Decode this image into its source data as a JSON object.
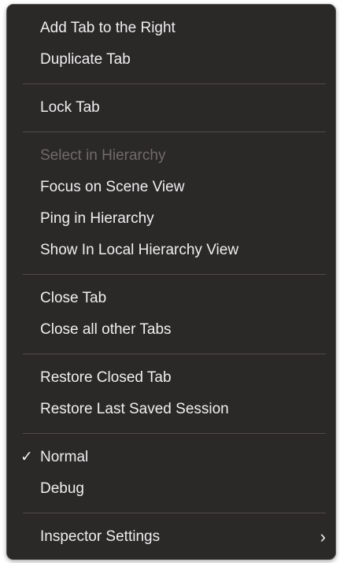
{
  "menu": {
    "groups": [
      {
        "items": [
          {
            "label": "Add Tab to the Right",
            "enabled": true
          },
          {
            "label": "Duplicate Tab",
            "enabled": true
          }
        ]
      },
      {
        "items": [
          {
            "label": "Lock Tab",
            "enabled": true
          }
        ]
      },
      {
        "items": [
          {
            "label": "Select in Hierarchy",
            "enabled": false
          },
          {
            "label": "Focus on Scene View",
            "enabled": true
          },
          {
            "label": "Ping in Hierarchy",
            "enabled": true
          },
          {
            "label": "Show In Local Hierarchy View",
            "enabled": true
          }
        ]
      },
      {
        "items": [
          {
            "label": "Close Tab",
            "enabled": true
          },
          {
            "label": "Close all other Tabs",
            "enabled": true
          }
        ]
      },
      {
        "items": [
          {
            "label": "Restore Closed Tab",
            "enabled": true
          },
          {
            "label": "Restore Last Saved Session",
            "enabled": true
          }
        ]
      },
      {
        "items": [
          {
            "label": "Normal",
            "enabled": true,
            "checked": true,
            "check_glyph": "✓"
          },
          {
            "label": "Debug",
            "enabled": true
          }
        ]
      },
      {
        "items": [
          {
            "label": "Inspector Settings",
            "enabled": true,
            "submenu_arrow": "›"
          }
        ]
      }
    ],
    "colors": {
      "background": "#2b2828",
      "text": "#efefef",
      "disabled_text": "#6f6b6b",
      "separator": "#4f4b4b"
    },
    "icons": {
      "checkmark": "checkmark-icon",
      "submenu": "chevron-right-icon"
    }
  }
}
